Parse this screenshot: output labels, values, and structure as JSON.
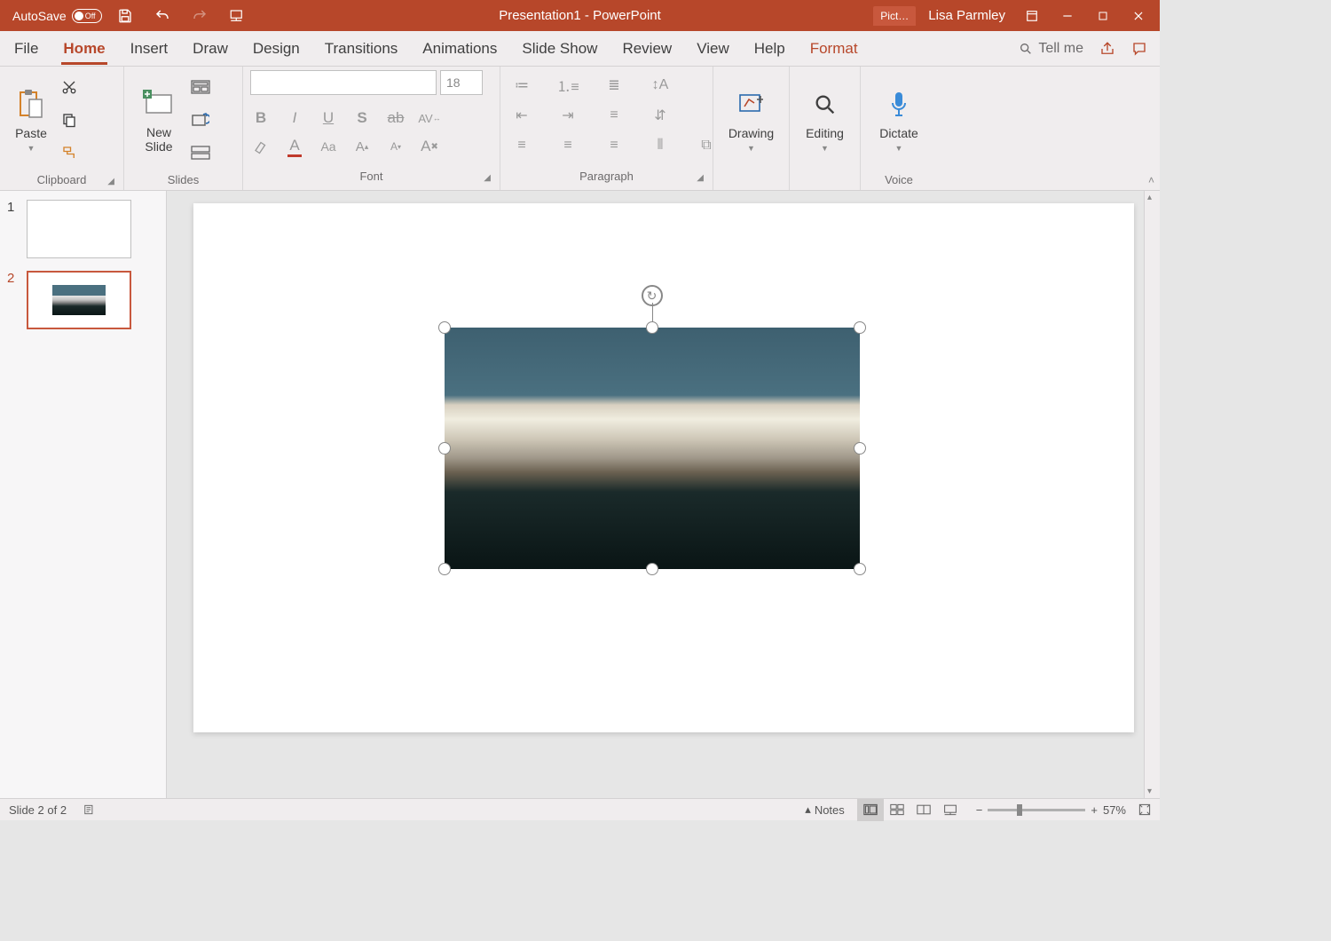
{
  "titlebar": {
    "autosave_label": "AutoSave",
    "autosave_state": "Off",
    "doc_title": "Presentation1  -  PowerPoint",
    "context_tab": "Pict…",
    "user": "Lisa Parmley"
  },
  "tabs": {
    "file": "File",
    "home": "Home",
    "insert": "Insert",
    "draw": "Draw",
    "design": "Design",
    "transitions": "Transitions",
    "animations": "Animations",
    "slideshow": "Slide Show",
    "review": "Review",
    "view": "View",
    "help": "Help",
    "format": "Format",
    "tellme": "Tell me"
  },
  "ribbon": {
    "clipboard": {
      "paste": "Paste",
      "label": "Clipboard"
    },
    "slides": {
      "newslide": "New\nSlide",
      "label": "Slides"
    },
    "font": {
      "label": "Font",
      "size": "18"
    },
    "paragraph": {
      "label": "Paragraph"
    },
    "drawing": {
      "btn": "Drawing",
      "label": ""
    },
    "editing": {
      "btn": "Editing",
      "label": ""
    },
    "voice": {
      "btn": "Dictate",
      "label": "Voice"
    }
  },
  "thumbs": [
    {
      "num": "1",
      "active": false,
      "has_img": false
    },
    {
      "num": "2",
      "active": true,
      "has_img": true
    }
  ],
  "status": {
    "left": "Slide 2 of 2",
    "notes": "Notes",
    "zoom": "57%"
  }
}
